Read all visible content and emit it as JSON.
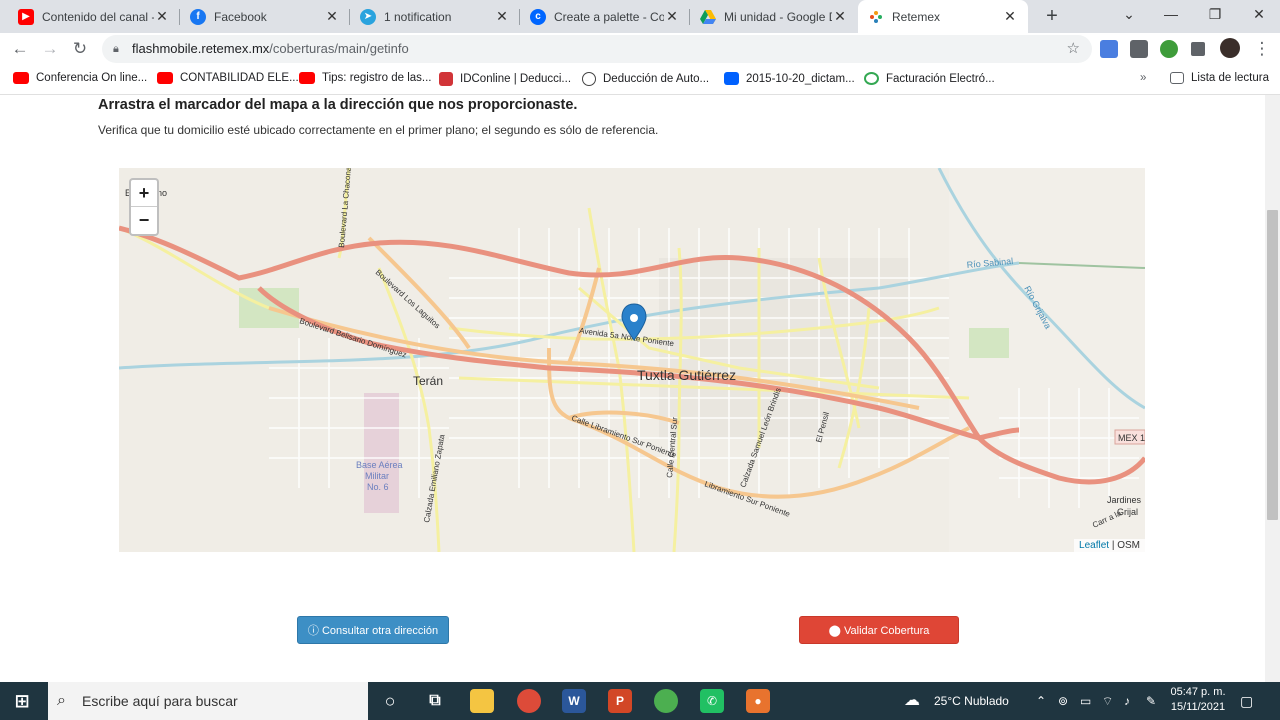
{
  "browser": {
    "tabs": [
      {
        "title": "Contenido del canal -",
        "icon": "youtube-icon"
      },
      {
        "title": "Facebook",
        "icon": "facebook-icon"
      },
      {
        "title": "1 notification",
        "icon": "telegram-icon"
      },
      {
        "title": "Create a palette - Coo",
        "icon": "coolors-icon"
      },
      {
        "title": "Mi unidad - Google D",
        "icon": "google-drive-icon"
      },
      {
        "title": "Retemex",
        "icon": "retemex-icon"
      }
    ],
    "url": {
      "host": "flashmobile.retemex.mx",
      "path": "/coberturas/main/getinfo"
    },
    "bookmarks": [
      {
        "label": "Conferencia On line...",
        "icon": "youtube-icon"
      },
      {
        "label": "CONTABILIDAD ELE...",
        "icon": "youtube-icon"
      },
      {
        "label": "Tips: registro de las...",
        "icon": "youtube-icon"
      },
      {
        "label": "IDConline | Deducci...",
        "icon": "idc-icon"
      },
      {
        "label": "Deducción de Auto...",
        "icon": "info-icon"
      },
      {
        "label": "2015-10-20_dictam...",
        "icon": "dropbox-icon"
      },
      {
        "label": "Facturación Electró...",
        "icon": "link-icon"
      }
    ],
    "reading_list": "Lista de lectura"
  },
  "page": {
    "heading": "Arrastra el marcador del mapa a la dirección que nos proporcionaste.",
    "subtext": "Verifica que tu domicilio esté ubicado correctamente en el primer plano; el segundo es sólo de referencia.",
    "map": {
      "zoom_in": "+",
      "zoom_out": "−",
      "labels": {
        "city": "Tuxtla Gutiérrez",
        "teran": "Terán",
        "base": [
          "Base Aérea",
          "Militar",
          "No. 6"
        ],
        "avenida": "Avenida 5a Norte Poniente",
        "belisario": "Boulevard Belisario Domínguez",
        "lagartos": "Boulevard Los Laguitos",
        "chacona": "Boulevard La Chacona",
        "libramiento": "Calle Libramiento Sur Poniente",
        "libramiento2": "Libramiento Sur Poniente",
        "central": "Calle Central Sur",
        "leon": "Calzada Samuel León Brindis",
        "pensil": "El Pensil",
        "zapata": "Calzada Emiliano Zapata",
        "rio": "Río Sabinal",
        "grijalva": "Río Grijalva",
        "mex": "MEX 1",
        "jardines": [
          "Jardines",
          "Grijal"
        ],
        "corner": "E",
        "corner2": "no",
        "carr": "Carr a la"
      },
      "attribution": {
        "leaflet": "Leaflet",
        "sep": " | ",
        "osm": "OSM"
      }
    },
    "buttons": {
      "consultar": "Consultar otra dirección",
      "validar": "Validar Cobertura"
    }
  },
  "taskbar": {
    "search_placeholder": "Escribe aquí para buscar",
    "weather": "25°C  Nublado",
    "time": "05:47 p. m.",
    "date": "15/11/2021"
  },
  "colors": {
    "primary_button": "#3d8fc5",
    "danger_button": "#df4636",
    "major_road": "#e9917f",
    "secondary_road": "#f6c78f",
    "tertiary_road": "#f5f0a0"
  }
}
